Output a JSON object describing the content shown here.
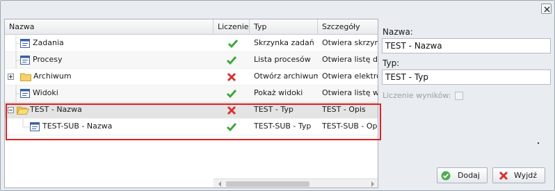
{
  "grid": {
    "columns": {
      "name": "Nazwa",
      "counting": "Liczenie",
      "type": "Typ",
      "details": "Szczegóły"
    },
    "rows": [
      {
        "name": "Zadania",
        "type": "Skrzynka zadań",
        "details": "Otwiera skrzynk",
        "status": "ok",
        "icon": "list-icon"
      },
      {
        "name": "Procesy",
        "type": "Lista procesów",
        "details": "Otwiera listę do",
        "status": "ok",
        "icon": "list-icon"
      },
      {
        "name": "Archiwum",
        "type": "Otwórz archiwum",
        "details": "Otwiera elektron",
        "status": "error",
        "icon": "folder-icon"
      },
      {
        "name": "Widoki",
        "type": "Pokaż widoki",
        "details": "Otwiera listę ws",
        "status": "ok",
        "icon": "list-icon"
      },
      {
        "name": "TEST - Nazwa",
        "type": "TEST - Typ",
        "details": "TEST - Opis",
        "status": "error",
        "icon": "folder-open-icon"
      },
      {
        "name": "TEST-SUB - Nazwa",
        "type": "TEST-SUB - Typ",
        "details": "TEST-SUB - Opis",
        "status": "ok",
        "icon": "list-icon"
      }
    ]
  },
  "form": {
    "name_label": "Nazwa:",
    "name_value": "TEST - Nazwa",
    "type_label": "Typ:",
    "type_value": "TEST - Typ",
    "counting_label": "Liczenie wyników:"
  },
  "buttons": {
    "add": "Dodaj",
    "exit": "Wyjdź"
  },
  "colors": {
    "highlight": "#e02020",
    "ok": "#3aa83a",
    "error": "#d93030"
  }
}
